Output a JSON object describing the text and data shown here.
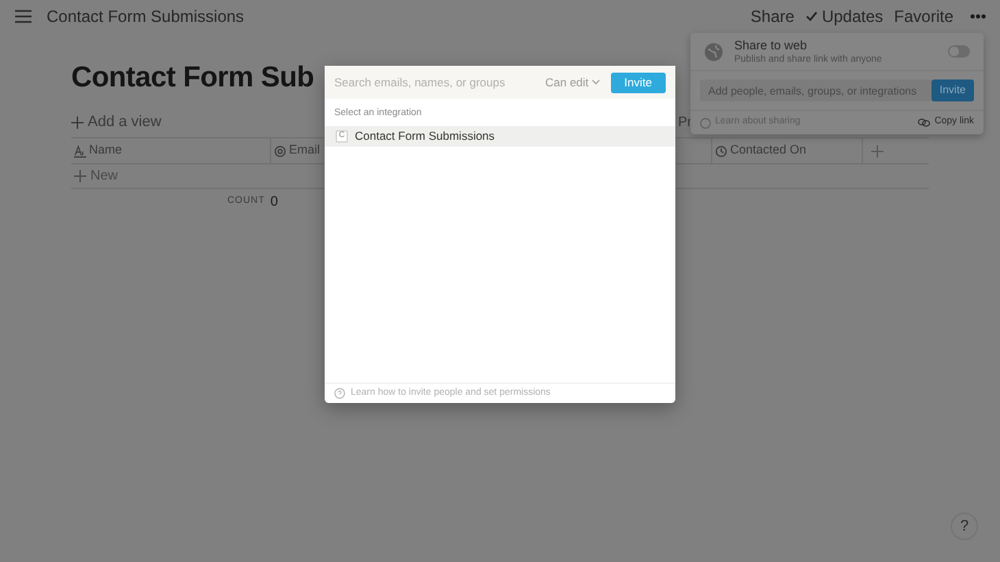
{
  "topbar": {
    "breadcrumb": "Contact Form Submissions",
    "actions": [
      {
        "label": "Share"
      },
      {
        "label": "Updates"
      },
      {
        "label": "Favorite"
      }
    ]
  },
  "page": {
    "title": "Contact Form Sub",
    "add_view": "Add a view",
    "column_3": "Pr",
    "table": {
      "columns": [
        {
          "label": "Name"
        },
        {
          "label": "Email"
        },
        {
          "label": "Contacted On"
        }
      ],
      "new_row": "New",
      "count_label": "COUNT",
      "count": "0"
    }
  },
  "share_popup": {
    "title": "Share to web",
    "subtitle": "Publish and share link with anyone",
    "on": false,
    "invite_placeholder": "Add people, emails, groups, or integrations",
    "invite_button": "Invite",
    "learn": "Learn about sharing",
    "copy_link": "Copy link"
  },
  "invite_dialog": {
    "search_placeholder": "Search emails, names, or groups",
    "permission": "Can edit",
    "invite_button": "Invite",
    "section_label": "Select an integration",
    "items": [
      {
        "letter": "C",
        "label": "Contact Form Submissions",
        "selected": true
      }
    ],
    "footer": "Learn how to invite people and set permissions"
  },
  "help_button": "?"
}
